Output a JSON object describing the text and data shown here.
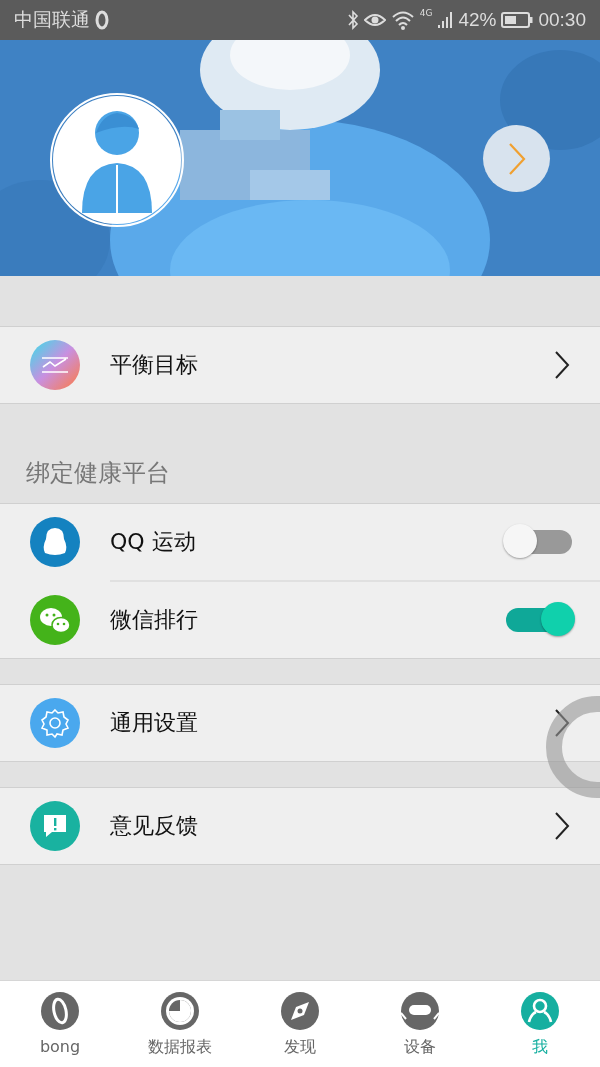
{
  "status_bar": {
    "carrier": "中国联通",
    "network": "4G",
    "battery": "42%",
    "time": "00:30"
  },
  "groups": [
    {
      "items": [
        {
          "kind": "link",
          "label": "平衡目标"
        }
      ]
    },
    {
      "title": "绑定健康平台",
      "items": [
        {
          "kind": "toggle",
          "label": "QQ 运动",
          "on": false
        },
        {
          "kind": "toggle",
          "label": "微信排行",
          "on": true
        }
      ]
    },
    {
      "items": [
        {
          "kind": "link",
          "label": "通用设置"
        }
      ]
    },
    {
      "items": [
        {
          "kind": "link",
          "label": "意见反馈"
        }
      ]
    }
  ],
  "tabs": [
    {
      "label": "bong",
      "selected": false
    },
    {
      "label": "数据报表",
      "selected": false
    },
    {
      "label": "发现",
      "selected": false
    },
    {
      "label": "设备",
      "selected": false
    },
    {
      "label": "我",
      "selected": true
    }
  ]
}
